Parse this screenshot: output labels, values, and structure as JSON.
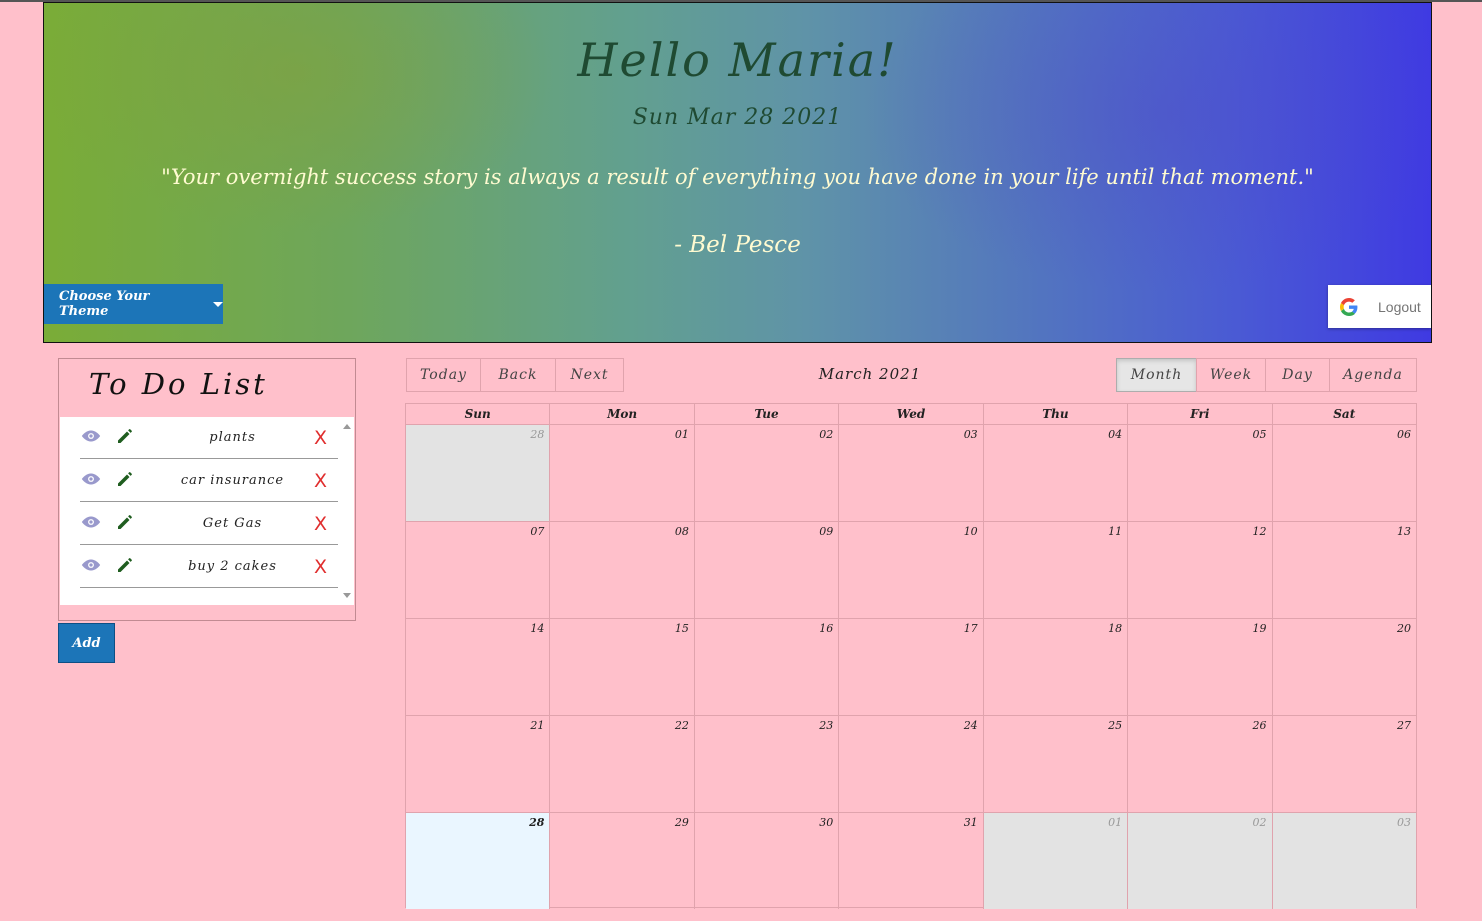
{
  "header": {
    "greeting": "Hello Maria!",
    "date": "Sun Mar 28 2021",
    "quote": "\"Your overnight success story is always a result of everything you have done in your life until that moment.\"",
    "author": "- Bel Pesce",
    "theme_button": "Choose Your Theme",
    "logout_button": "Logout"
  },
  "todo": {
    "title": "To Do List",
    "items": [
      {
        "label": "plants",
        "delete": "X"
      },
      {
        "label": "car insurance",
        "delete": "X"
      },
      {
        "label": "Get Gas",
        "delete": "X"
      },
      {
        "label": "buy 2 cakes",
        "delete": "X"
      }
    ],
    "add_button": "Add"
  },
  "calendar": {
    "nav": [
      "Today",
      "Back",
      "Next"
    ],
    "label": "March 2021",
    "views": [
      "Month",
      "Week",
      "Day",
      "Agenda"
    ],
    "active_view": "Month",
    "weekdays": [
      "Sun",
      "Mon",
      "Tue",
      "Wed",
      "Thu",
      "Fri",
      "Sat"
    ],
    "weeks": [
      [
        "28",
        "01",
        "02",
        "03",
        "04",
        "05",
        "06"
      ],
      [
        "07",
        "08",
        "09",
        "10",
        "11",
        "12",
        "13"
      ],
      [
        "14",
        "15",
        "16",
        "17",
        "18",
        "19",
        "20"
      ],
      [
        "21",
        "22",
        "23",
        "24",
        "25",
        "26",
        "27"
      ],
      [
        "28",
        "29",
        "30",
        "31",
        "01",
        "02",
        "03"
      ]
    ],
    "colors": {
      "off_range": "#e3e3e3",
      "today": "#eaf6ff",
      "accent": "#1c75b8",
      "page": "#ffc0cb"
    }
  }
}
